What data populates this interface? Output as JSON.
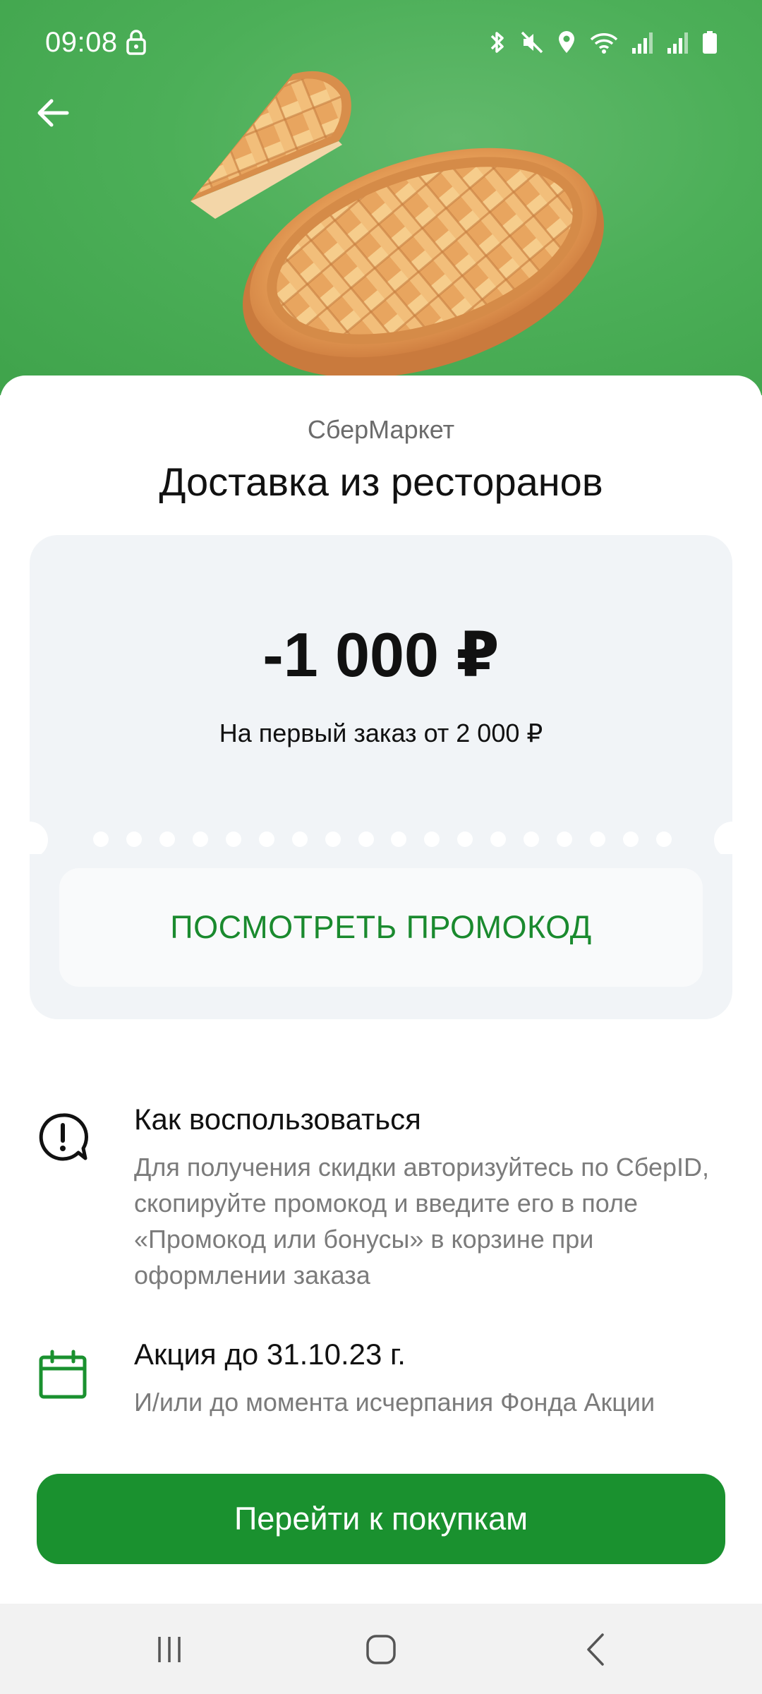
{
  "status_bar": {
    "time": "09:08"
  },
  "icons": {
    "back": "arrow-left-icon",
    "lock": "lock-icon",
    "info": "exclamation-bubble-icon",
    "calendar": "calendar-icon"
  },
  "offer": {
    "merchant": "СберМаркет",
    "title": "Доставка из ресторанов",
    "discount": "-1 000 ₽",
    "condition": "На первый заказ от 2 000 ₽",
    "promo_button": "ПОСМОТРЕТЬ ПРОМОКОД"
  },
  "how_to": {
    "heading": "Как воспользоваться",
    "body": "Для получения скидки авторизуйтесь по СберID, скопируйте промокод и введите его в поле «Промокод или бонусы» в корзине при оформлении заказа"
  },
  "validity": {
    "heading": "Акция до 31.10.23 г.",
    "body": "И/или до момента исчерпания Фонда Акции"
  },
  "cta": {
    "label": "Перейти к покупкам"
  },
  "colors": {
    "brand_green": "#1a912f",
    "hero_green": "#4caf58",
    "card_bg": "#f1f4f7"
  }
}
